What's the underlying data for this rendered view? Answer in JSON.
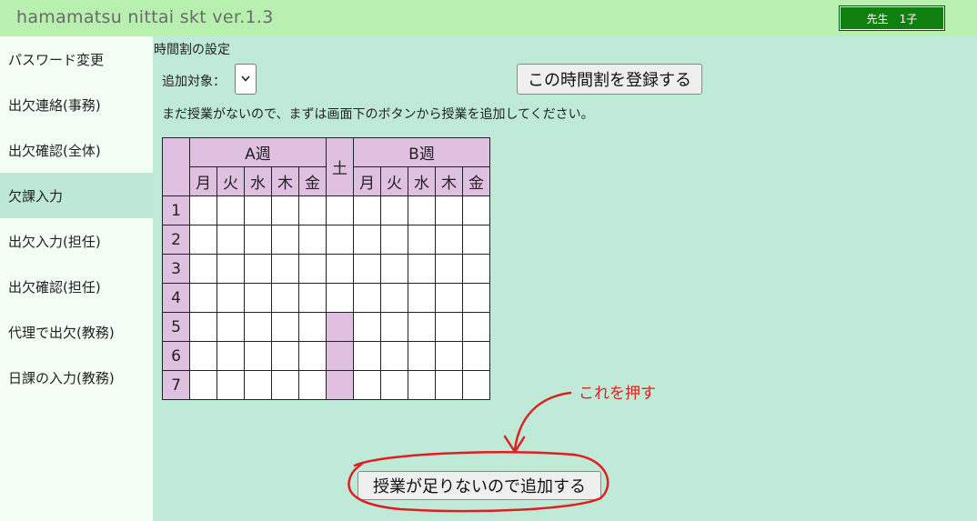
{
  "header": {
    "app_title": "hamamatsu nittai skt ver.1.3",
    "user_badge": "先生　1子"
  },
  "sidebar": {
    "items": [
      {
        "label": "パスワード変更"
      },
      {
        "label": "出欠連絡(事務)"
      },
      {
        "label": "出欠確認(全体)"
      },
      {
        "label": "欠課入力"
      },
      {
        "label": "出欠入力(担任)"
      },
      {
        "label": "出欠確認(担任)"
      },
      {
        "label": "代理で出欠(教務)"
      },
      {
        "label": "日課の入力(教務)"
      }
    ],
    "active_index": 3
  },
  "main": {
    "section_title": "時間割の設定",
    "target_label": "追加対象：",
    "target_select_value": "",
    "register_button": "この時間割を登録する",
    "notice": "まだ授業がないので、まずは画面下のボタンから授業を追加してください。",
    "timetable": {
      "week_a": "A週",
      "week_b": "B週",
      "saturday": "土",
      "days": [
        "月",
        "火",
        "水",
        "木",
        "金"
      ],
      "periods": [
        "1",
        "2",
        "3",
        "4",
        "5",
        "6",
        "7"
      ],
      "saturday_periods": 4
    },
    "add_button": "授業が足りないので追加する"
  },
  "annotation": {
    "text": "これを押す",
    "color": "#e02020"
  }
}
